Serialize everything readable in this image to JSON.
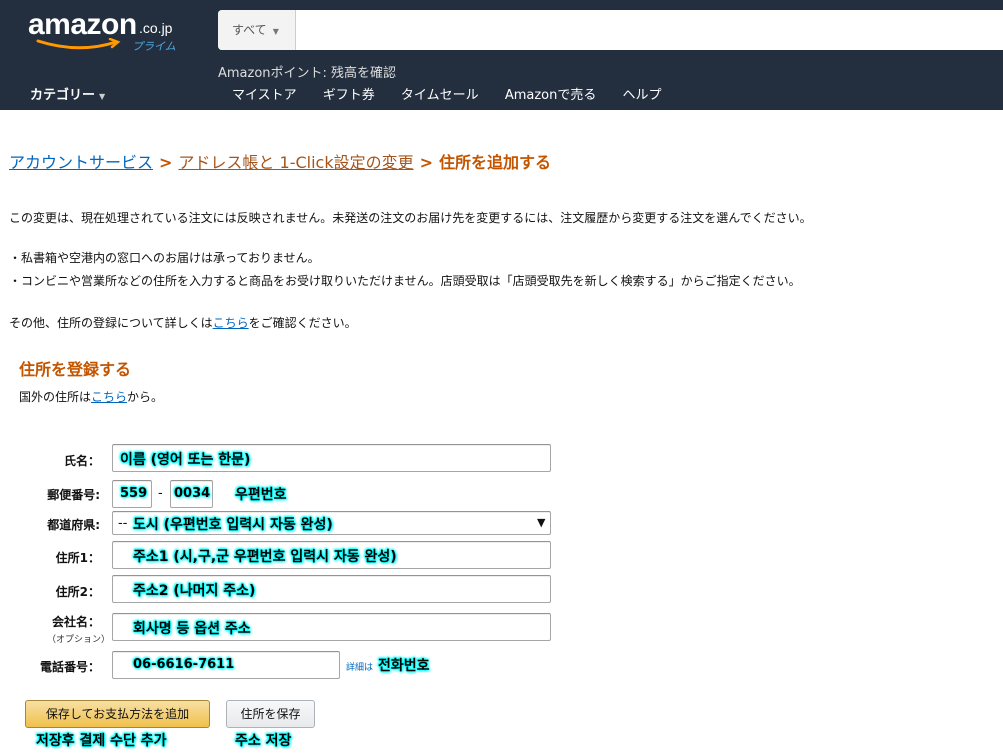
{
  "header": {
    "logo_text": "amazon",
    "logo_tld": ".co.jp",
    "logo_sub": "プライム",
    "search_scope": "すべて",
    "points_line": "Amazonポイント: 残高を確認",
    "category_menu": "カテゴリー",
    "nav_links": [
      "マイストア",
      "ギフト券",
      "タイムセール",
      "Amazonで売る",
      "ヘルプ"
    ],
    "colors": {
      "bg": "#232f3e",
      "accent": "#febd69"
    }
  },
  "breadcrumb": {
    "items": [
      "アカウントサービス",
      "アドレス帳と 1-Click設定の変更",
      "住所を追加する"
    ],
    "separator": ">"
  },
  "notices": {
    "line1": "この変更は、現在処理されている注文には反映されません。未発送の注文のお届け先を変更するには、注文履歴から変更する注文を選んでください。",
    "bullet1": "・私書箱や空港内の窓口へのお届けは承っておりません。",
    "bullet2": "・コンビニや営業所などの住所を入力すると商品をお受け取りいただけません。店頭受取は「店頭受取先を新しく検索する」からご指定ください。",
    "more_prefix": "その他、住所の登録について詳しくは",
    "more_link": "こちら",
    "more_suffix": "をご確認ください。"
  },
  "section": {
    "title": "住所を登録する",
    "intl_prefix": "国外の住所は",
    "intl_link": "こちら",
    "intl_suffix": "から。"
  },
  "form": {
    "name_label": "氏名：",
    "name_note": "이름 (영어 또는 한문)",
    "postal_label": "郵便番号:",
    "postal_1": "559",
    "postal_sep": "-",
    "postal_2": "0034",
    "postal_note": "우편번호",
    "pref_label": "都道府県:",
    "pref_prefix": "--",
    "pref_note": "도시 (우편번호 입력시 자동 완성)",
    "addr1_label": "住所1：",
    "addr1_note": "주소1 (시,구,군 우편번호 입력시 자동 완성)",
    "addr2_label": "住所2：",
    "addr2_note": "주소2 (나머지 주소)",
    "company_label": "会社名：",
    "company_sub": "（オプション）",
    "company_note": "회사명 등 옵션 주소",
    "phone_label": "電話番号：",
    "phone_value": "06-6616-7611",
    "phone_detail": "詳細は",
    "phone_note": "전화번호"
  },
  "buttons": {
    "pay_label": "保存してお支払方法を追加",
    "pay_note": "저장후 결제 수단 추가",
    "save_label": "住所を保存",
    "save_note": "주소 저장"
  }
}
